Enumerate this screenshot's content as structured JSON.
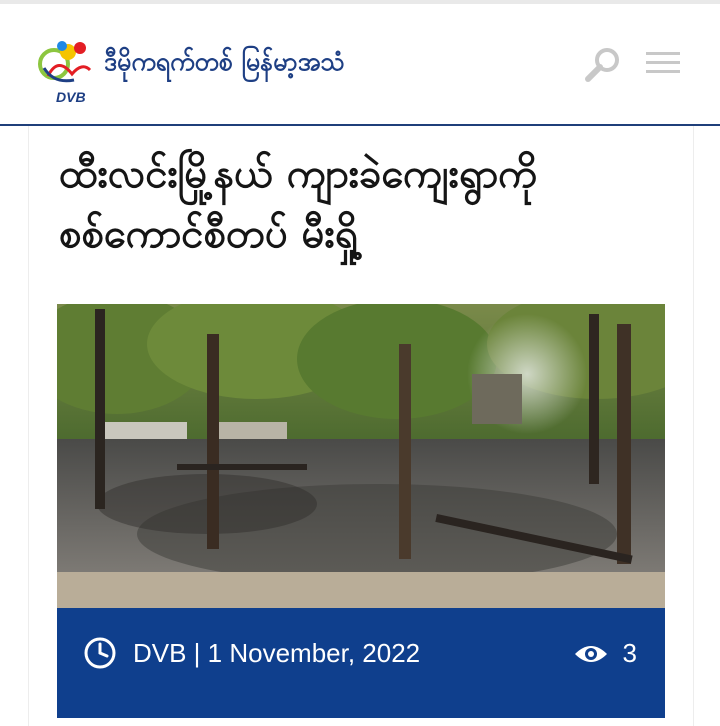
{
  "header": {
    "brand_name": "ဒီမိုကရက်တစ် မြန်မာ့အသံ",
    "logo_abbrev": "DVB",
    "search_icon": "search-icon",
    "menu_icon": "hamburger-menu-icon"
  },
  "article": {
    "title_line1": "ထီးလင်းမြို့နယ် ကျားခဲကျေးရွာကို",
    "title_line2": "စစ်ကောင်စီတပ် မီးရှို့",
    "meta": {
      "author_date": "DVB | 1 November, 2022",
      "views": "3",
      "clock_icon": "clock-icon",
      "eye_icon": "eye-icon"
    }
  },
  "colors": {
    "brand_blue": "#1e3f84",
    "meta_bar": "#0f3f8d",
    "headline": "#151515"
  }
}
